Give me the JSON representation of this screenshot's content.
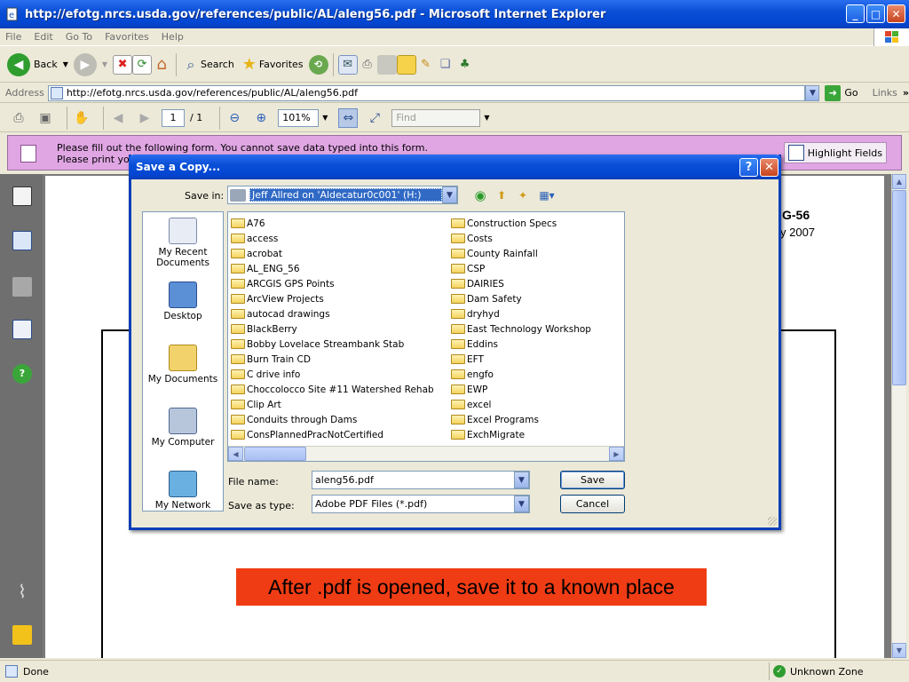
{
  "window": {
    "title": "http://efotg.nrcs.usda.gov/references/public/AL/aleng56.pdf - Microsoft Internet Explorer"
  },
  "menu": [
    "File",
    "Edit",
    "Go To",
    "Favorites",
    "Help"
  ],
  "toolbar": {
    "back_label": "Back",
    "search_label": "Search",
    "favorites_label": "Favorites"
  },
  "address": {
    "label": "Address",
    "url": "http://efotg.nrcs.usda.gov/references/public/AL/aleng56.pdf",
    "go_label": "Go",
    "links_label": "Links"
  },
  "acrobat": {
    "page_current": "1",
    "page_total": "/ 1",
    "zoom": "101%",
    "find_placeholder": "Find"
  },
  "notice": {
    "line1": "Please fill out the following form. You cannot save data typed into this form.",
    "line2": "Please print your co",
    "highlight_label": "Highlight Fields"
  },
  "document": {
    "heading_fragment": "G-56",
    "date_fragment": "y 2007",
    "caption": "After .pdf is opened, save it to a known place"
  },
  "dialog": {
    "title": "Save a Copy...",
    "save_in_label": "Save in:",
    "save_in_value": "Jeff Allred on 'Aldecatur0c001' (H:)",
    "places": [
      "My Recent Documents",
      "Desktop",
      "My Documents",
      "My Computer",
      "My Network"
    ],
    "folders_col1": [
      "A76",
      "access",
      "acrobat",
      "AL_ENG_56",
      "ARCGIS GPS Points",
      "ArcView Projects",
      "autocad drawings",
      "BlackBerry",
      "Bobby Lovelace Streambank Stab",
      "Burn Train CD",
      "C drive info",
      "Choccolocco Site #11 Watershed Rehab",
      "Clip Art",
      "Conduits through Dams",
      "ConsPlannedPracNotCertified"
    ],
    "folders_col2": [
      "Construction Specs",
      "Costs",
      "County Rainfall",
      "CSP",
      "DAIRIES",
      "Dam Safety",
      "dryhyd",
      "East Technology Workshop",
      "Eddins",
      "EFT",
      "engfo",
      "EWP",
      "excel",
      "Excel Programs",
      "ExchMigrate"
    ],
    "file_name_label": "File name:",
    "file_name_value": "aleng56.pdf",
    "save_as_type_label": "Save as type:",
    "save_as_type_value": "Adobe PDF Files (*.pdf)",
    "save_label": "Save",
    "cancel_label": "Cancel"
  },
  "status": {
    "left": "Done",
    "zone": "Unknown Zone"
  }
}
